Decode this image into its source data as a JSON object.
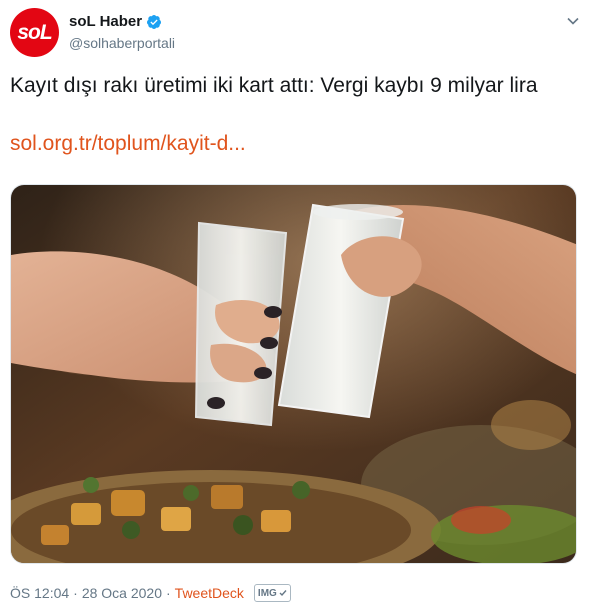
{
  "header": {
    "avatar_text": "soL",
    "display_name": "soL Haber",
    "handle": "@solhaberportali",
    "verified_icon": "verified-badge-icon",
    "menu_icon": "chevron-down-icon"
  },
  "tweet": {
    "text": "Kayıt dışı rakı üretimi iki kart attı: Vergi kaybı 9 milyar lira",
    "link": "sol.org.tr/toplum/kayit-d..."
  },
  "meta": {
    "time": "ÖS 12:04",
    "separator": "·",
    "date": "28 Oca 2020",
    "source": "TweetDeck",
    "badge": "IMG"
  },
  "colors": {
    "brand_red": "#e30613",
    "link": "#e0541d",
    "muted": "#657786",
    "verified": "#1da1f2"
  }
}
